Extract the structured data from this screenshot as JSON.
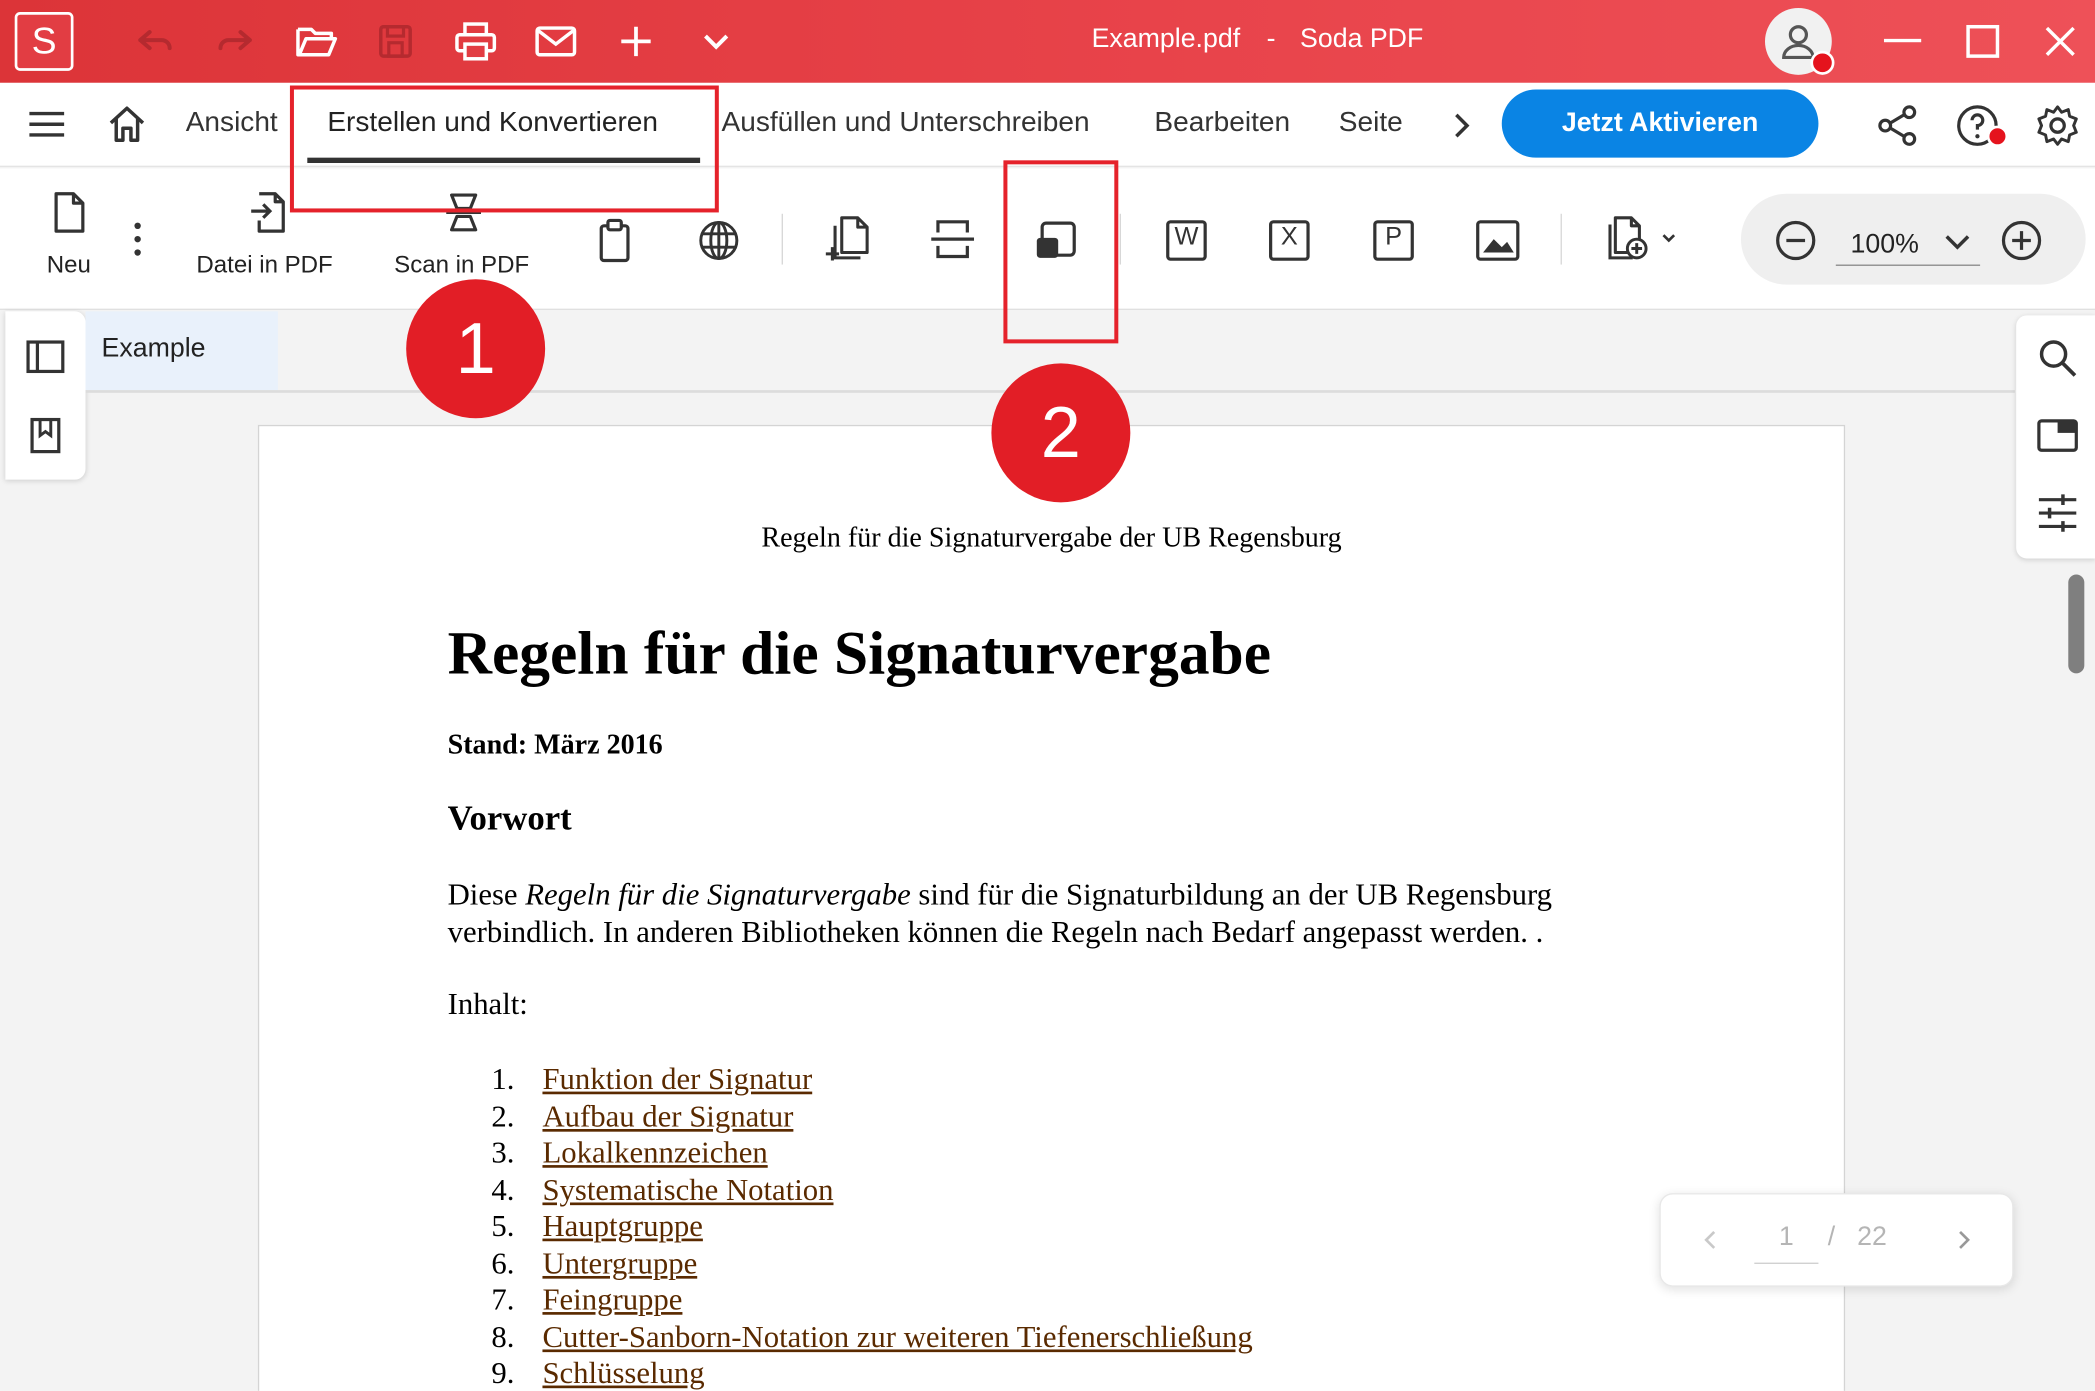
{
  "titlebar": {
    "app_logo_letter": "S",
    "file_name": "Example.pdf",
    "dash": "-",
    "app_name": "Soda PDF"
  },
  "menu": {
    "tabs": [
      "Ansicht",
      "Erstellen und Konvertieren",
      "Ausfüllen und Unterschreiben",
      "Bearbeiten",
      "Seite"
    ],
    "active_tab": "Erstellen und Konvertieren",
    "activate_button": "Jetzt Aktivieren"
  },
  "ribbon": {
    "new_label": "Neu",
    "file_to_pdf_label": "Datei in PDF",
    "scan_to_pdf_label": "Scan in PDF",
    "word_letter": "W",
    "excel_letter": "X",
    "ppt_letter": "P",
    "zoom_value": "100%"
  },
  "annotations": {
    "badge_1": "1",
    "badge_2": "2"
  },
  "document": {
    "tab_name": "Example",
    "header_line": "Regeln für die Signaturvergabe der UB Regensburg",
    "heading": "Regeln für die Signaturvergabe",
    "stand": "Stand: März 2016",
    "section": "Vorwort",
    "para_pre": "Diese ",
    "para_italic": "Regeln für die Signaturvergabe",
    "para_post": " sind für die Signaturbildung an der UB Regensburg",
    "para_line2": "verbindlich. In anderen Bibliotheken können die Regeln nach Bedarf angepasst werden. .",
    "contents_label": "Inhalt:",
    "toc": [
      {
        "num": "1.",
        "text": "Funktion der Signatur"
      },
      {
        "num": "2.",
        "text": "Aufbau der Signatur"
      },
      {
        "num": "3.",
        "text": "Lokalkennzeichen"
      },
      {
        "num": "4.",
        "text": "Systematische Notation"
      },
      {
        "num": "5.",
        "text": "Hauptgruppe"
      },
      {
        "num": "6.",
        "text": "Untergruppe"
      },
      {
        "num": "7.",
        "text": "Feingruppe"
      },
      {
        "num": "8.",
        "text": "Cutter-Sanborn-Notation zur weiteren Tiefenerschließung"
      },
      {
        "num": "9.",
        "text": "Schlüsselung"
      }
    ]
  },
  "pager": {
    "current_page": "1",
    "separator": "/",
    "total_pages": "22"
  },
  "colors": {
    "titlebar": "#e23d43",
    "accent_blue": "#0a84e4",
    "annotation_red": "#e21e26",
    "link_brown": "#5a2a00"
  }
}
